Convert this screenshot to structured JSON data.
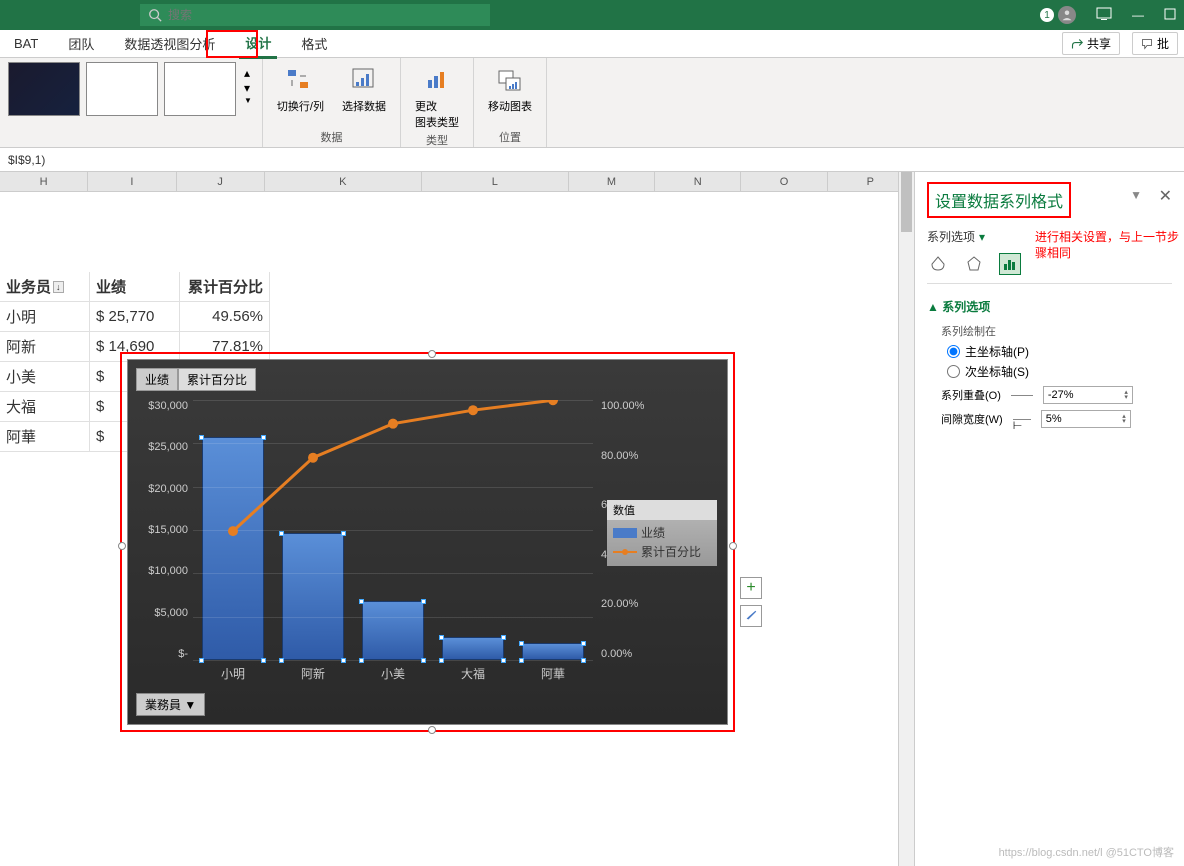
{
  "titlebar": {
    "search_placeholder": "搜索",
    "user_number": "1"
  },
  "tabs": {
    "items": [
      "BAT",
      "团队",
      "数据透视图分析",
      "设计",
      "格式"
    ],
    "share": "共享",
    "batch": "批"
  },
  "ribbon": {
    "switch_rc": "切换行/列",
    "select_data": "选择数据",
    "group_data": "数据",
    "change_type": "更改\n图表类型",
    "group_type": "类型",
    "move_chart": "移动图表",
    "group_pos": "位置"
  },
  "formula": "$I$9,1)",
  "columns": [
    "H",
    "I",
    "J",
    "K",
    "L",
    "M",
    "N",
    "O",
    "P"
  ],
  "table": {
    "headers": [
      "业务员",
      "业绩",
      "累计百分比"
    ],
    "rows": [
      {
        "name": "小明",
        "val": "$   25,770",
        "pct": "49.56%"
      },
      {
        "name": "阿新",
        "val": "$   14,690",
        "pct": "77.81%"
      },
      {
        "name": "小美",
        "val": "$",
        "pct": ""
      },
      {
        "name": "大福",
        "val": "$",
        "pct": ""
      },
      {
        "name": "阿華",
        "val": "$",
        "pct": ""
      }
    ]
  },
  "chart_data": {
    "type": "bar",
    "categories": [
      "小明",
      "阿新",
      "小美",
      "大福",
      "阿華"
    ],
    "series": [
      {
        "name": "业绩",
        "values": [
          25770,
          14690,
          6800,
          2700,
          2000
        ],
        "axis": "primary",
        "kind": "bar"
      },
      {
        "name": "累计百分比",
        "values": [
          49.56,
          77.81,
          90.89,
          96.08,
          99.92
        ],
        "axis": "secondary",
        "kind": "line"
      }
    ],
    "ylabel_primary": [
      "$30,000",
      "$25,000",
      "$20,000",
      "$15,000",
      "$10,000",
      "$5,000",
      "$-"
    ],
    "ylabel_secondary": [
      "100.00%",
      "80.00%",
      "60.00%",
      "40.00%",
      "20.00%",
      "0.00%"
    ],
    "legend_title": "数值",
    "tabs": [
      "业绩",
      "累计百分比"
    ],
    "filter_label": "業務員"
  },
  "float": {
    "plus": "+",
    "brush": ""
  },
  "panel": {
    "title": "设置数据系列格式",
    "sub": "系列选项",
    "note": "进行相关设置，与上一节步骤相同",
    "section": "系列选项",
    "plot_on": "系列绘制在",
    "primary": "主坐标轴(P)",
    "secondary": "次坐标轴(S)",
    "overlap_label": "系列重叠(O)",
    "overlap_val": "-27%",
    "gap_label": "间隙宽度(W)",
    "gap_val": "5%"
  },
  "watermark": "https://blog.csdn.net/l @51CTO博客"
}
